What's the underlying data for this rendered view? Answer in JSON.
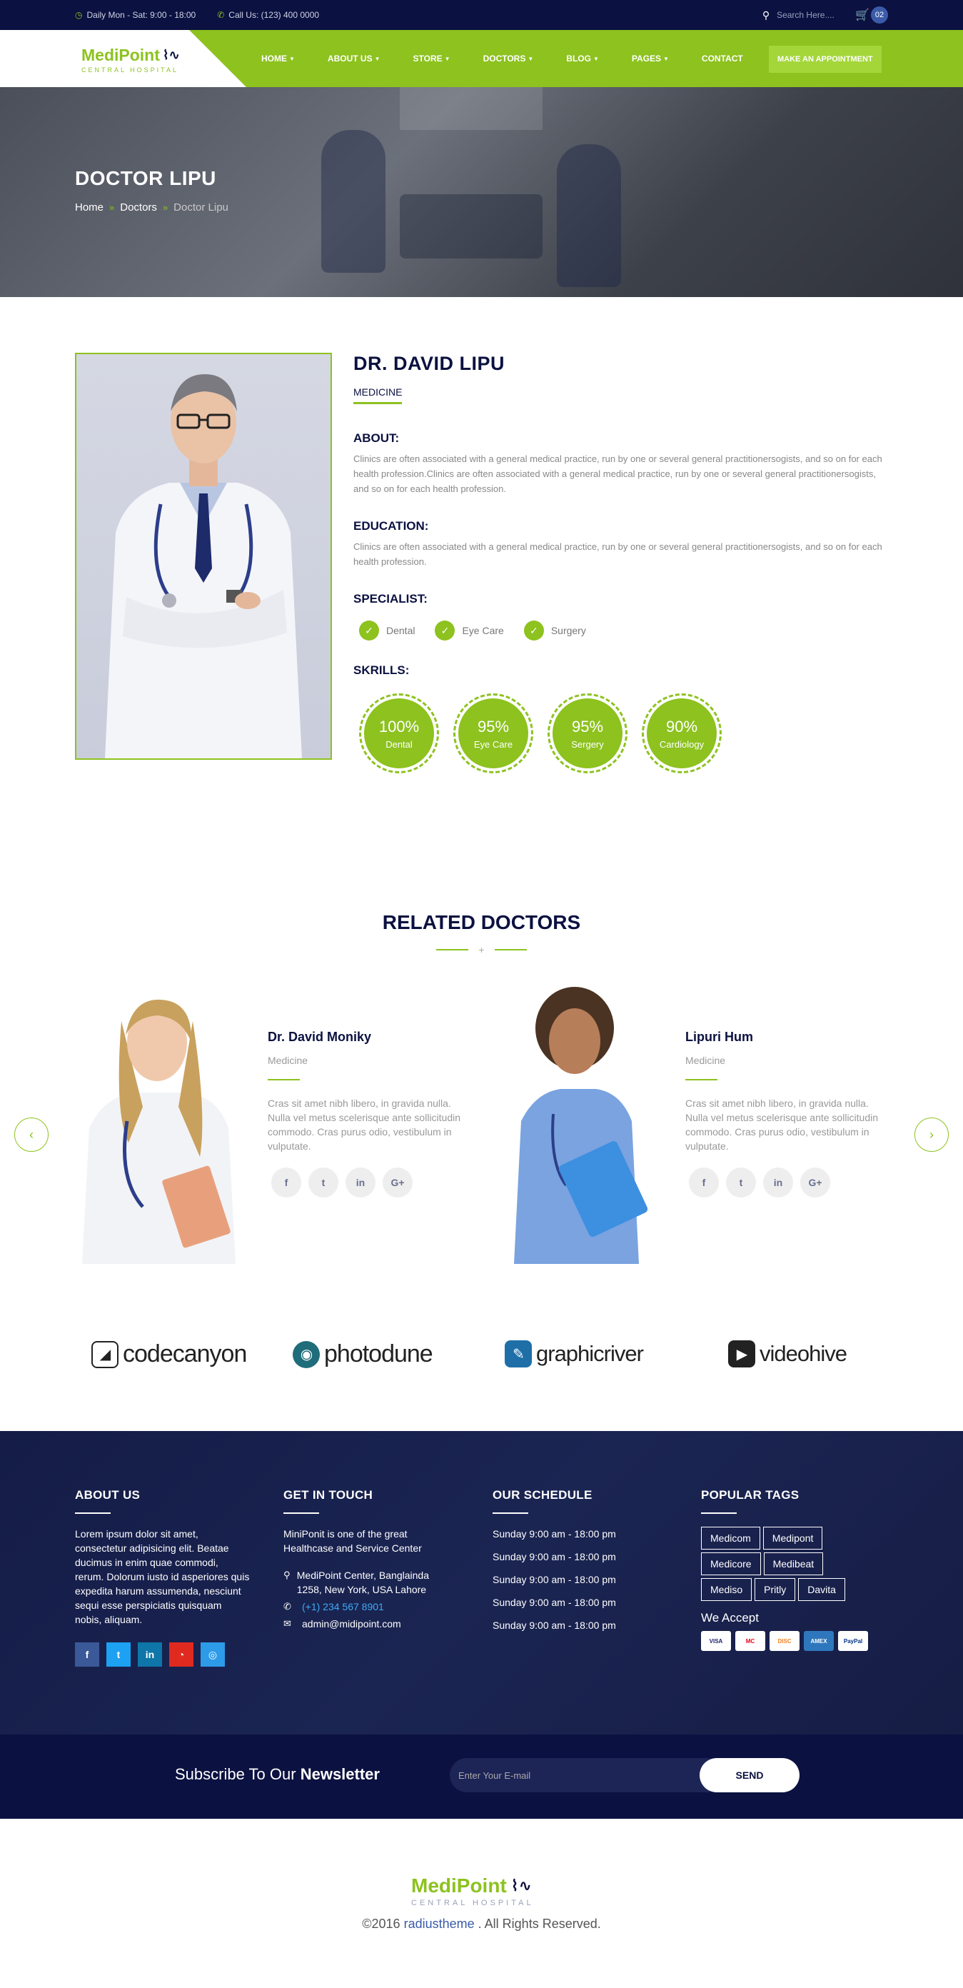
{
  "topbar": {
    "hours": "Daily Mon - Sat: 9:00 - 18:00",
    "phone": "Call Us: (123) 400 0000",
    "search_placeholder": "Search Here....",
    "cart_count": "02"
  },
  "brand": {
    "name": "MediPoint",
    "sub": "CENTRAL HOSPITAL"
  },
  "nav": {
    "items": [
      "HOME",
      "ABOUT US",
      "STORE",
      "DOCTORS",
      "BLOG",
      "PAGES",
      "CONTACT"
    ],
    "appointment": "MAKE AN APPOINTMENT"
  },
  "banner": {
    "title": "DOCTOR LIPU",
    "breadcrumb": [
      "Home",
      "Doctors",
      "Doctor Lipu"
    ]
  },
  "doctor": {
    "name": "DR. DAVID LIPU",
    "dept": "MEDICINE",
    "about_title": "ABOUT:",
    "about_text": "Clinics are often associated with a general medical practice, run by one or several general practitionersogists, and so on for each health profession.Clinics are often associated with a general medical practice, run by one or several general practitionersogists, and so on for each health profession.",
    "edu_title": "EDUCATION:",
    "edu_text": "Clinics are often associated with a general medical practice, run by one or several general practitionersogists, and so on for each health profession.",
    "spec_title": "SPECIALIST:",
    "specialties": [
      "Dental",
      "Eye Care",
      "Surgery"
    ],
    "skills_title": "SKRILLS:",
    "skills": [
      {
        "pct": "100%",
        "label": "Dental"
      },
      {
        "pct": "95%",
        "label": "Eye Care"
      },
      {
        "pct": "95%",
        "label": "Sergery"
      },
      {
        "pct": "90%",
        "label": "Cardiology"
      }
    ]
  },
  "related": {
    "title": "RELATED DOCTORS",
    "divider_mark": "+",
    "doctors": [
      {
        "name": "Dr. David Moniky",
        "dept": "Medicine",
        "desc": "Cras sit amet nibh libero, in gravida nulla. Nulla vel metus scelerisque ante sollicitudin commodo. Cras purus odio, vestibulum in vulputate."
      },
      {
        "name": "Lipuri Hum",
        "dept": "Medicine",
        "desc": "Cras sit amet nibh libero, in gravida nulla. Nulla vel metus scelerisque ante sollicitudin commodo. Cras purus odio, vestibulum in vulputate."
      }
    ]
  },
  "brands": [
    "codecanyon",
    "photodune",
    "graphicriver",
    "videohive"
  ],
  "footer": {
    "about_title": "ABOUT US",
    "about_text": "Lorem ipsum dolor sit amet, consectetur adipisicing elit. Beatae ducimus in enim quae commodi, rerum. Dolorum iusto id asperiores quis expedita harum assumenda, nesciunt sequi esse perspiciatis quisquam nobis, aliquam.",
    "touch_title": "GET IN TOUCH",
    "touch_text": "MiniPonit is one of the great Healthcase and Service Center",
    "address": "MediPoint Center, Banglainda 1258, New York, USA Lahore",
    "phone": "(+1) 234 567 8901",
    "email": "admin@midipoint.com",
    "schedule_title": "OUR SCHEDULE",
    "schedule": [
      "Sunday 9:00 am - 18:00 pm",
      "Sunday 9:00 am - 18:00 pm",
      "Sunday 9:00 am - 18:00 pm",
      "Sunday 9:00 am - 18:00 pm",
      "Sunday 9:00 am - 18:00 pm"
    ],
    "tags_title": "POPULAR TAGS",
    "tags": [
      "Medicom",
      "Medipont",
      "Medicore",
      "Medibeat",
      "Mediso",
      "Pritly",
      "Davita"
    ],
    "accept_title": "We Accept",
    "cards": [
      "VISA",
      "MC",
      "DISC",
      "AMEX",
      "PayPal"
    ]
  },
  "newsletter": {
    "title_a": "Subscribe To Our",
    "title_b": "Newsletter",
    "placeholder": "Enter Your E-mail",
    "button": "SEND"
  },
  "bottom": {
    "copyright_pre": "©2016",
    "copyright_brand": "radiustheme",
    "copyright_post": ". All Rights Reserved."
  },
  "colors": {
    "accent": "#8dc21f",
    "navy": "#0b1140"
  }
}
